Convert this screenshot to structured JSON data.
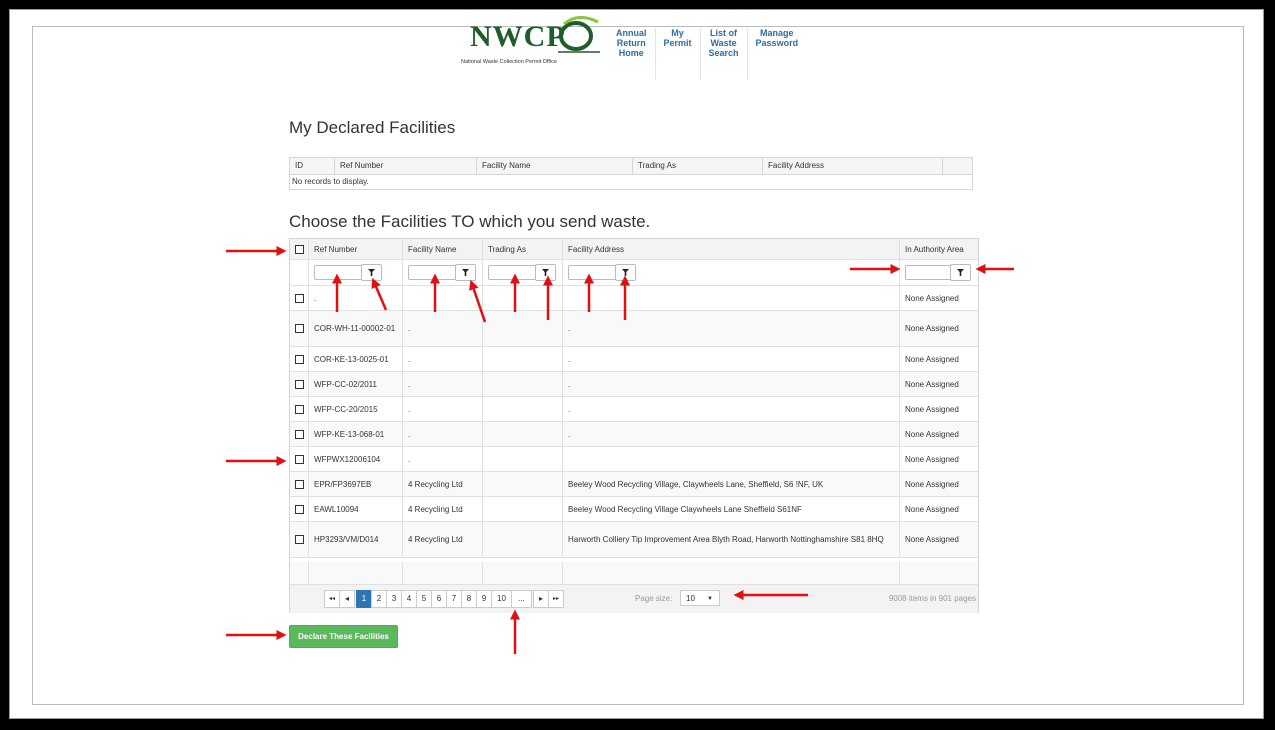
{
  "brand": {
    "logo_text": "NWCP",
    "logo_subtitle": "National Waste Collection Permit Office",
    "colors": {
      "logo_green": "#1f5d2b",
      "link_blue": "#2e6da4",
      "button_green": "#5cb85c",
      "pager_selected": "#2e75b6",
      "annotation_red": "#e01010"
    }
  },
  "nav": [
    {
      "label": "Annual\nReturn\nHome"
    },
    {
      "label": "My\nPermit"
    },
    {
      "label": "List of\nWaste\nSearch"
    },
    {
      "label": "Manage\nPassword"
    }
  ],
  "declared": {
    "heading": "My Declared Facilities",
    "columns": [
      "ID",
      "Ref Number",
      "Facility Name",
      "Trading As",
      "Facility Address",
      ""
    ],
    "empty_message": "No records to display."
  },
  "choose": {
    "heading": "Choose the Facilities TO which you send waste.",
    "columns": [
      "Ref Number",
      "Facility Name",
      "Trading As",
      "Facility Address",
      "In Authority Area"
    ],
    "filter_icon": "filter-icon",
    "rows": [
      {
        "ref": ".",
        "name": "",
        "trading": "",
        "address": "",
        "area": "None Assigned"
      },
      {
        "ref": "COR-WH-11-00002-01",
        "name": ".",
        "trading": "",
        "address": ".",
        "area": "None Assigned"
      },
      {
        "ref": "COR-KE-13-0025-01",
        "name": ".",
        "trading": "",
        "address": ".",
        "area": "None Assigned"
      },
      {
        "ref": "WFP-CC-02/2011",
        "name": ".",
        "trading": "",
        "address": ".",
        "area": "None Assigned"
      },
      {
        "ref": "WFP-CC-20/2015",
        "name": ".",
        "trading": "",
        "address": ".",
        "area": "None Assigned"
      },
      {
        "ref": "WFP-KE-13-068-01",
        "name": ".",
        "trading": "",
        "address": ".",
        "area": "None Assigned"
      },
      {
        "ref": "WFPWX12006104",
        "name": ".",
        "trading": "",
        "address": "",
        "area": "None Assigned"
      },
      {
        "ref": "EPR/FP3697EB",
        "name": "4 Recycling Ltd",
        "trading": "",
        "address": "Beeley Wood Recycling Village, Claywheels Lane, Sheffield, S6 !NF, UK",
        "area": "None Assigned"
      },
      {
        "ref": "EAWL10094",
        "name": "4 Recycling Ltd",
        "trading": "",
        "address": "Beeley Wood Recycling Village Claywheels Lane Sheffield S61NF",
        "area": "None Assigned"
      },
      {
        "ref": "HP3293/VM/D014",
        "name": "4 Recycling Ltd",
        "trading": "",
        "address": "Harworth Colliery Tip Improvement Area Blyth Road, Harworth Nottinghamshire S81 8HQ",
        "area": "None Assigned"
      }
    ]
  },
  "pager": {
    "first": "◂◂",
    "prev": "◂",
    "pages": [
      "1",
      "2",
      "3",
      "4",
      "5",
      "6",
      "7",
      "8",
      "9",
      "10",
      "..."
    ],
    "selected_page": "1",
    "next": "▸",
    "last": "▸▸",
    "page_size_label": "Page size:",
    "page_size": "10",
    "items_info": "9008 items in 901 pages"
  },
  "declare_button": "Declare These Facilities"
}
